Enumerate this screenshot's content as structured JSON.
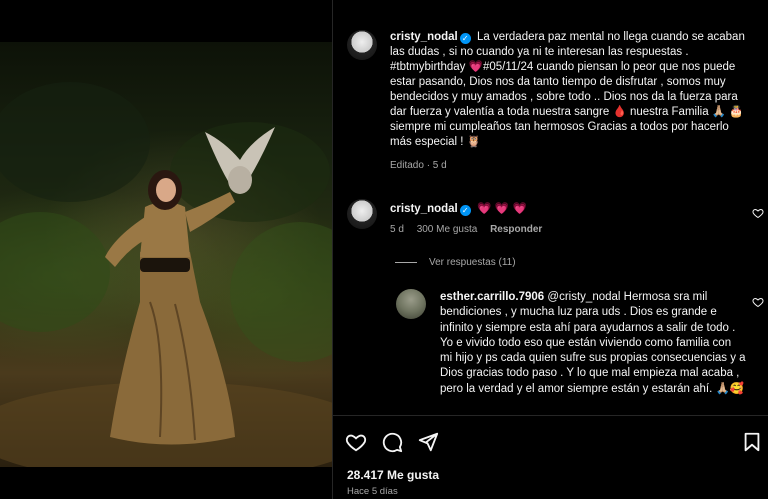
{
  "post": {
    "author": "cristy_nodal",
    "caption": "La verdadera paz mental no llega cuando se acaban las dudas , si no cuando ya ni te interesan las respuestas . #tbtmybirthday 💗#05/11/24 cuando piensan lo peor que nos puede estar pasando, Dios nos da tanto tiempo de disfrutar , somos muy bendecidos y muy amados , sobre todo .. Dios nos da la fuerza para dar fuerza y valentía a toda nuestra sangre 🩸 nuestra Familia 🙏🏼 🎂 siempre mi cumpleaños tan hermosos Gracias a todos por hacerlo más especial ! 🦉",
    "caption_meta": "Editado · 5 d"
  },
  "comments": [
    {
      "author": "cristy_nodal",
      "text": "💗 💗 💗",
      "age": "5 d",
      "likes": "300 Me gusta",
      "reply_label": "Responder",
      "view_replies": "Ver respuestas (11)"
    }
  ],
  "reply": {
    "author": "esther.carrillo.7906",
    "text": "@cristy_nodal Hermosa sra mil bendiciones , y mucha luz para uds . Dios es grande e infinito y siempre esta ahí para ayudarnos a salir de todo . Yo e vivido todo eso que están viviendo como familia con mi hijo y ps cada quien sufre sus propias consecuencias y a Dios gracias todo paso . Y lo que mal empieza mal acaba , pero la verdad y el amor siempre están y estarán ahí. 🙏🏼🥰"
  },
  "footer": {
    "likes": "28.417 Me gusta",
    "time": "Hace 5 días"
  },
  "icons": {
    "like": "heart-icon",
    "comment": "comment-icon",
    "share": "share-icon",
    "save": "bookmark-icon"
  },
  "colors": {
    "verified": "#0095f6",
    "muted": "#a8a8a8",
    "background": "#000000"
  }
}
